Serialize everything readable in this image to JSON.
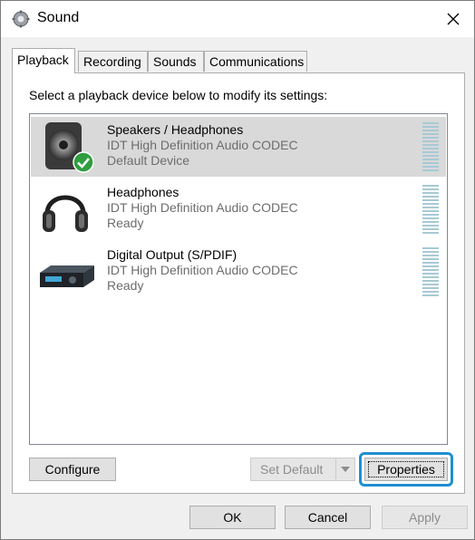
{
  "window": {
    "title": "Sound",
    "icon": "speaker-gear-icon",
    "close_icon": "close-icon"
  },
  "tabs": [
    {
      "label": "Playback",
      "active": true
    },
    {
      "label": "Recording",
      "active": false
    },
    {
      "label": "Sounds",
      "active": false
    },
    {
      "label": "Communications",
      "active": false
    }
  ],
  "playback": {
    "instruction": "Select a playback device below to modify its settings:",
    "devices": [
      {
        "name": "Speakers / Headphones",
        "driver": "IDT High Definition Audio CODEC",
        "status": "Default Device",
        "icon": "speaker-icon",
        "selected": true,
        "default_badge": "green-check-icon"
      },
      {
        "name": "Headphones",
        "driver": "IDT High Definition Audio CODEC",
        "status": "Ready",
        "icon": "headphones-icon",
        "selected": false
      },
      {
        "name": "Digital Output (S/PDIF)",
        "driver": "IDT High Definition Audio CODEC",
        "status": "Ready",
        "icon": "receiver-icon",
        "selected": false
      }
    ],
    "configure_label": "Configure",
    "set_default_label": "Set Default",
    "properties_label": "Properties"
  },
  "footer": {
    "ok_label": "OK",
    "cancel_label": "Cancel",
    "apply_label": "Apply"
  },
  "colors": {
    "selection": "#d9d9d9",
    "highlight": "#1f8fd1",
    "meter": "#a8c9d6"
  }
}
